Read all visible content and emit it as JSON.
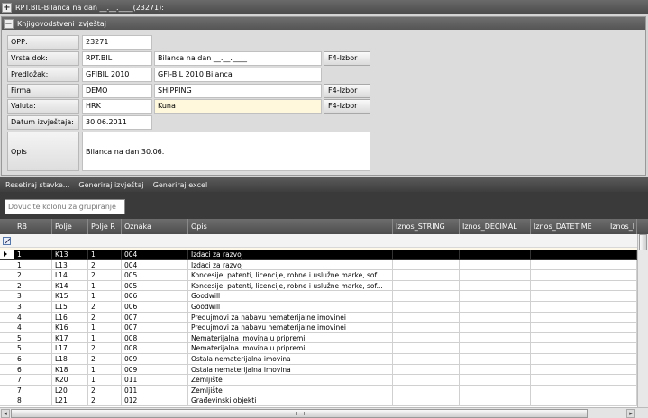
{
  "window": {
    "title": "RPT.BIL-Bilanca na dan __.__.____(23271):"
  },
  "section": {
    "title": "Knjigovodstveni izvještaj"
  },
  "form": {
    "opp": {
      "label": "OPP:",
      "value": "23271"
    },
    "vrsta_dok": {
      "label": "Vrsta dok:",
      "code": "RPT.BIL",
      "name": "Bilanca na dan __.__.____",
      "button": "F4-Izbor"
    },
    "predlozak": {
      "label": "Predložak:",
      "code": "GFIBIL 2010",
      "name": "GFI-BIL 2010 Bilanca"
    },
    "firma": {
      "label": "Firma:",
      "code": "DEMO",
      "name": "SHIPPING",
      "button": "F4-Izbor"
    },
    "valuta": {
      "label": "Valuta:",
      "code": "HRK",
      "name": "Kuna",
      "button": "F4-Izbor"
    },
    "datum": {
      "label": "Datum izvještaja:",
      "value": "30.06.2011"
    },
    "opis": {
      "label": "Opis",
      "value": "Bilanca na dan 30.06."
    }
  },
  "toolbar": {
    "reset": "Resetiraj stavke...",
    "generate_report": "Generiraj izvještaj",
    "generate_excel": "Generiraj excel"
  },
  "grouping": {
    "placeholder": "Dovucite kolonu za grupiranje"
  },
  "grid": {
    "headers": {
      "rb": "RB",
      "polje": "Polje",
      "polje_r": "Polje R",
      "oznaka": "Oznaka",
      "opis": "Opis",
      "iznos_string": "Iznos_STRING",
      "iznos_decimal": "Iznos_DECIMAL",
      "iznos_datetime": "Iznos_DATETIME",
      "iznos_i": "Iznos_I"
    },
    "rows": [
      {
        "rb": "1",
        "polje": "K13",
        "polje_r": "1",
        "oznaka": "004",
        "opis": "Izdaci za razvoj"
      },
      {
        "rb": "1",
        "polje": "L13",
        "polje_r": "2",
        "oznaka": "004",
        "opis": "Izdaci za razvoj"
      },
      {
        "rb": "2",
        "polje": "L14",
        "polje_r": "2",
        "oznaka": "005",
        "opis": "Koncesije, patenti, licencije, robne i uslužne marke, sof..."
      },
      {
        "rb": "2",
        "polje": "K14",
        "polje_r": "1",
        "oznaka": "005",
        "opis": "Koncesije, patenti, licencije, robne i uslužne marke, sof..."
      },
      {
        "rb": "3",
        "polje": "K15",
        "polje_r": "1",
        "oznaka": "006",
        "opis": "Goodwill"
      },
      {
        "rb": "3",
        "polje": "L15",
        "polje_r": "2",
        "oznaka": "006",
        "opis": "Goodwill"
      },
      {
        "rb": "4",
        "polje": "L16",
        "polje_r": "2",
        "oznaka": "007",
        "opis": "Predujmovi za nabavu nematerijalne imovinei"
      },
      {
        "rb": "4",
        "polje": "K16",
        "polje_r": "1",
        "oznaka": "007",
        "opis": "Predujmovi za nabavu nematerijalne imovinei"
      },
      {
        "rb": "5",
        "polje": "K17",
        "polje_r": "1",
        "oznaka": "008",
        "opis": "Nematerijalna imovina u pripremi"
      },
      {
        "rb": "5",
        "polje": "L17",
        "polje_r": "2",
        "oznaka": "008",
        "opis": "Nematerijalna imovina u pripremi"
      },
      {
        "rb": "6",
        "polje": "L18",
        "polje_r": "2",
        "oznaka": "009",
        "opis": "Ostala nematerijalna imovina"
      },
      {
        "rb": "6",
        "polje": "K18",
        "polje_r": "1",
        "oznaka": "009",
        "opis": "Ostala nematerijalna imovina"
      },
      {
        "rb": "7",
        "polje": "K20",
        "polje_r": "1",
        "oznaka": "011",
        "opis": "Zemljište"
      },
      {
        "rb": "7",
        "polje": "L20",
        "polje_r": "2",
        "oznaka": "011",
        "opis": "Zemljište"
      },
      {
        "rb": "8",
        "polje": "L21",
        "polje_r": "2",
        "oznaka": "012",
        "opis": "Građevinski objekti"
      }
    ]
  }
}
